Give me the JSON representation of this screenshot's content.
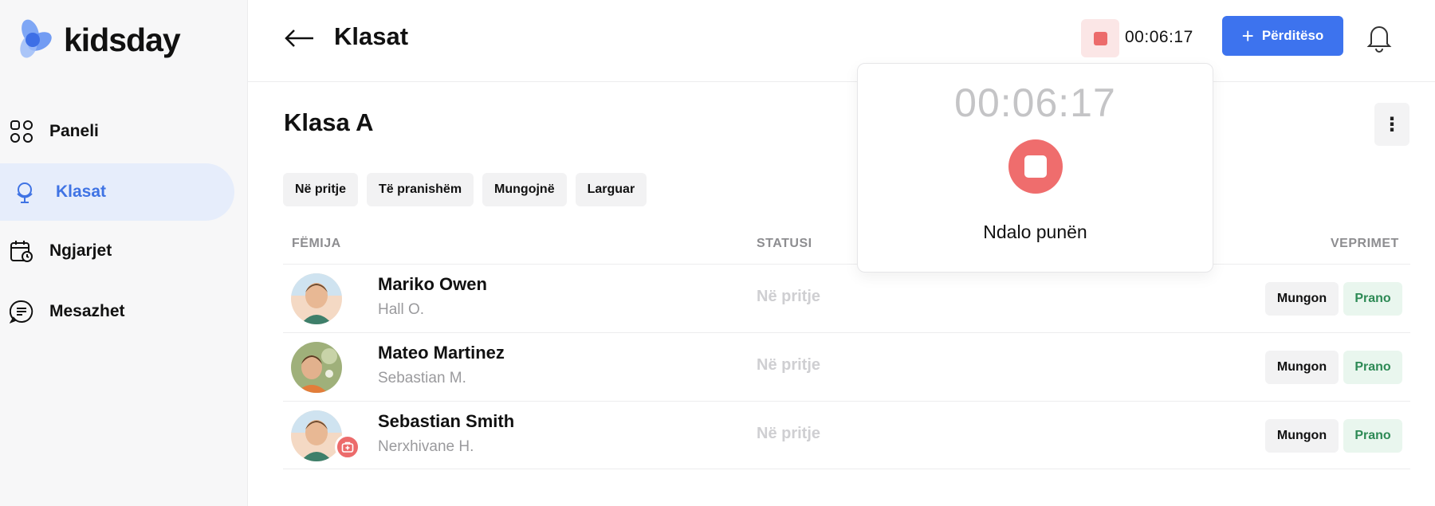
{
  "app": {
    "brand": "kidsday",
    "accent": "#3d73ee",
    "danger": "#ec6b6b",
    "success": "#2d8a55"
  },
  "sidebar": {
    "items": [
      {
        "label": "Paneli",
        "icon": "grid-icon",
        "active": false
      },
      {
        "label": "Klasat",
        "icon": "globe-icon",
        "active": true
      },
      {
        "label": "Ngjarjet",
        "icon": "calendar-clock-icon",
        "active": false
      },
      {
        "label": "Mesazhet",
        "icon": "message-icon",
        "active": false
      }
    ]
  },
  "header": {
    "title": "Klasat",
    "timer": "00:06:17",
    "update_label": "Përditëso"
  },
  "main": {
    "class_title": "Klasa A",
    "filters": [
      "Në pritje",
      "Të pranishëm",
      "Mungojnë",
      "Larguar"
    ],
    "columns": {
      "child": "FËMIJA",
      "status": "STATUSI",
      "actions": "VEPRIMET"
    },
    "rows": [
      {
        "name": "Mariko Owen",
        "guardian": "Hall O.",
        "status": "Në pritje",
        "absent": "Mungon",
        "accept": "Prano"
      },
      {
        "name": "Mateo Martinez",
        "guardian": "Sebastian M.",
        "status": "Në pritje",
        "absent": "Mungon",
        "accept": "Prano"
      },
      {
        "name": "Sebastian Smith",
        "guardian": "Nerxhivane H.",
        "status": "Në pritje",
        "absent": "Mungon",
        "accept": "Prano"
      }
    ]
  },
  "popover": {
    "timer": "00:06:17",
    "stop_label": "Ndalo punën"
  }
}
